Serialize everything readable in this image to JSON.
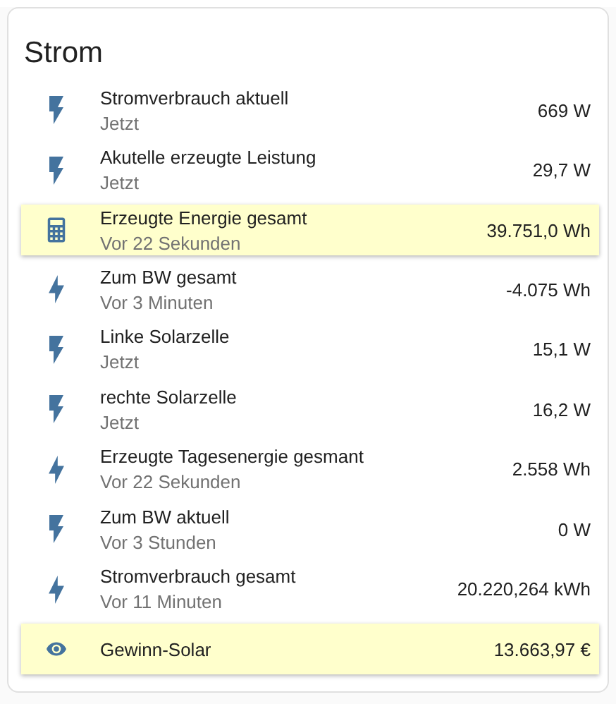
{
  "card": {
    "title": "Strom",
    "rows": [
      {
        "kind": "flash",
        "name": "Stromverbrauch aktuell",
        "time": "Jetzt",
        "value": "669 W",
        "highlighted": false
      },
      {
        "kind": "flash",
        "name": "Akutelle erzeugte Leistung",
        "time": "Jetzt",
        "value": "29,7 W",
        "highlighted": false
      },
      {
        "kind": "calculator",
        "name": "Erzeugte Energie gesamt",
        "time": "Vor 22 Sekunden",
        "value": "39.751,0 Wh",
        "highlighted": true
      },
      {
        "kind": "bolt",
        "name": "Zum BW gesamt",
        "time": "Vor 3 Minuten",
        "value": "-4.075 Wh",
        "highlighted": false
      },
      {
        "kind": "flash",
        "name": "Linke Solarzelle",
        "time": "Jetzt",
        "value": "15,1 W",
        "highlighted": false
      },
      {
        "kind": "flash",
        "name": "rechte Solarzelle",
        "time": "Jetzt",
        "value": "16,2 W",
        "highlighted": false
      },
      {
        "kind": "bolt",
        "name": "Erzeugte Tagesenergie gesmant",
        "time": "Vor 22 Sekunden",
        "value": "2.558 Wh",
        "highlighted": false
      },
      {
        "kind": "flash",
        "name": "Zum BW aktuell",
        "time": "Vor 3 Stunden",
        "value": "0 W",
        "highlighted": false
      },
      {
        "kind": "bolt",
        "name": "Stromverbrauch gesamt",
        "time": "Vor 11 Minuten",
        "value": "20.220,264 kWh",
        "highlighted": false
      },
      {
        "kind": "eye",
        "name": "Gewinn-Solar",
        "value": "13.663,97 €",
        "highlighted": true
      }
    ]
  }
}
